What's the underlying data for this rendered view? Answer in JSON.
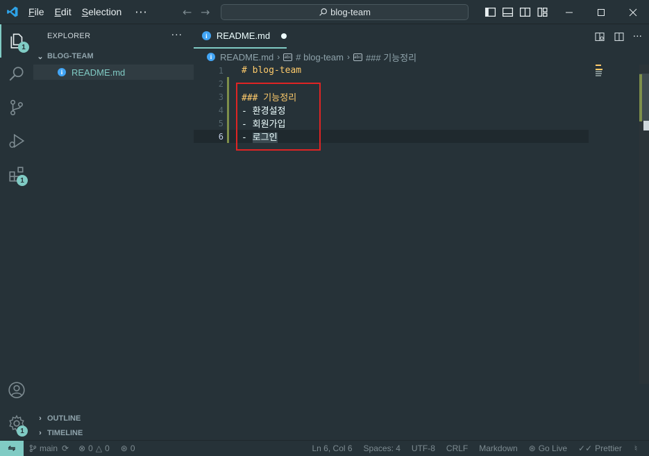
{
  "titlebar": {
    "menus": [
      "File",
      "Edit",
      "Selection"
    ],
    "more_label": "···",
    "search_text": "blog-team"
  },
  "activity": {
    "explorer_badge": "1",
    "extensions_badge": "1",
    "manage_badge": "1"
  },
  "sidebar": {
    "title": "EXPLORER",
    "more_label": "···",
    "folder_name": "BLOG-TEAM",
    "file_name": "README.md",
    "outline_label": "OUTLINE",
    "timeline_label": "TIMELINE"
  },
  "editor": {
    "tab_name": "README.md",
    "breadcrumb": [
      "README.md",
      "# blog-team",
      "### 기능정리"
    ],
    "lines": [
      {
        "num": "1",
        "prefix": "#",
        "text": " blog-team"
      },
      {
        "num": "2",
        "prefix": "",
        "text": ""
      },
      {
        "num": "3",
        "prefix": "###",
        "text": " 기능정리"
      },
      {
        "num": "4",
        "prefix": "-",
        "text": " 환경설정"
      },
      {
        "num": "5",
        "prefix": "-",
        "text": " 회원가입"
      },
      {
        "num": "6",
        "prefix": "-",
        "text": "로그인"
      }
    ]
  },
  "statusbar": {
    "branch": "main",
    "errors": "0",
    "warnings": "0",
    "ports": "0",
    "position": "Ln 6, Col 6",
    "spaces": "Spaces: 4",
    "encoding": "UTF-8",
    "eol": "CRLF",
    "language": "Markdown",
    "golive": "Go Live",
    "prettier": "Prettier"
  },
  "colors": {
    "accent": "#80cbc4",
    "heading": "#ffcb6b",
    "highlight_box": "#e02424"
  }
}
